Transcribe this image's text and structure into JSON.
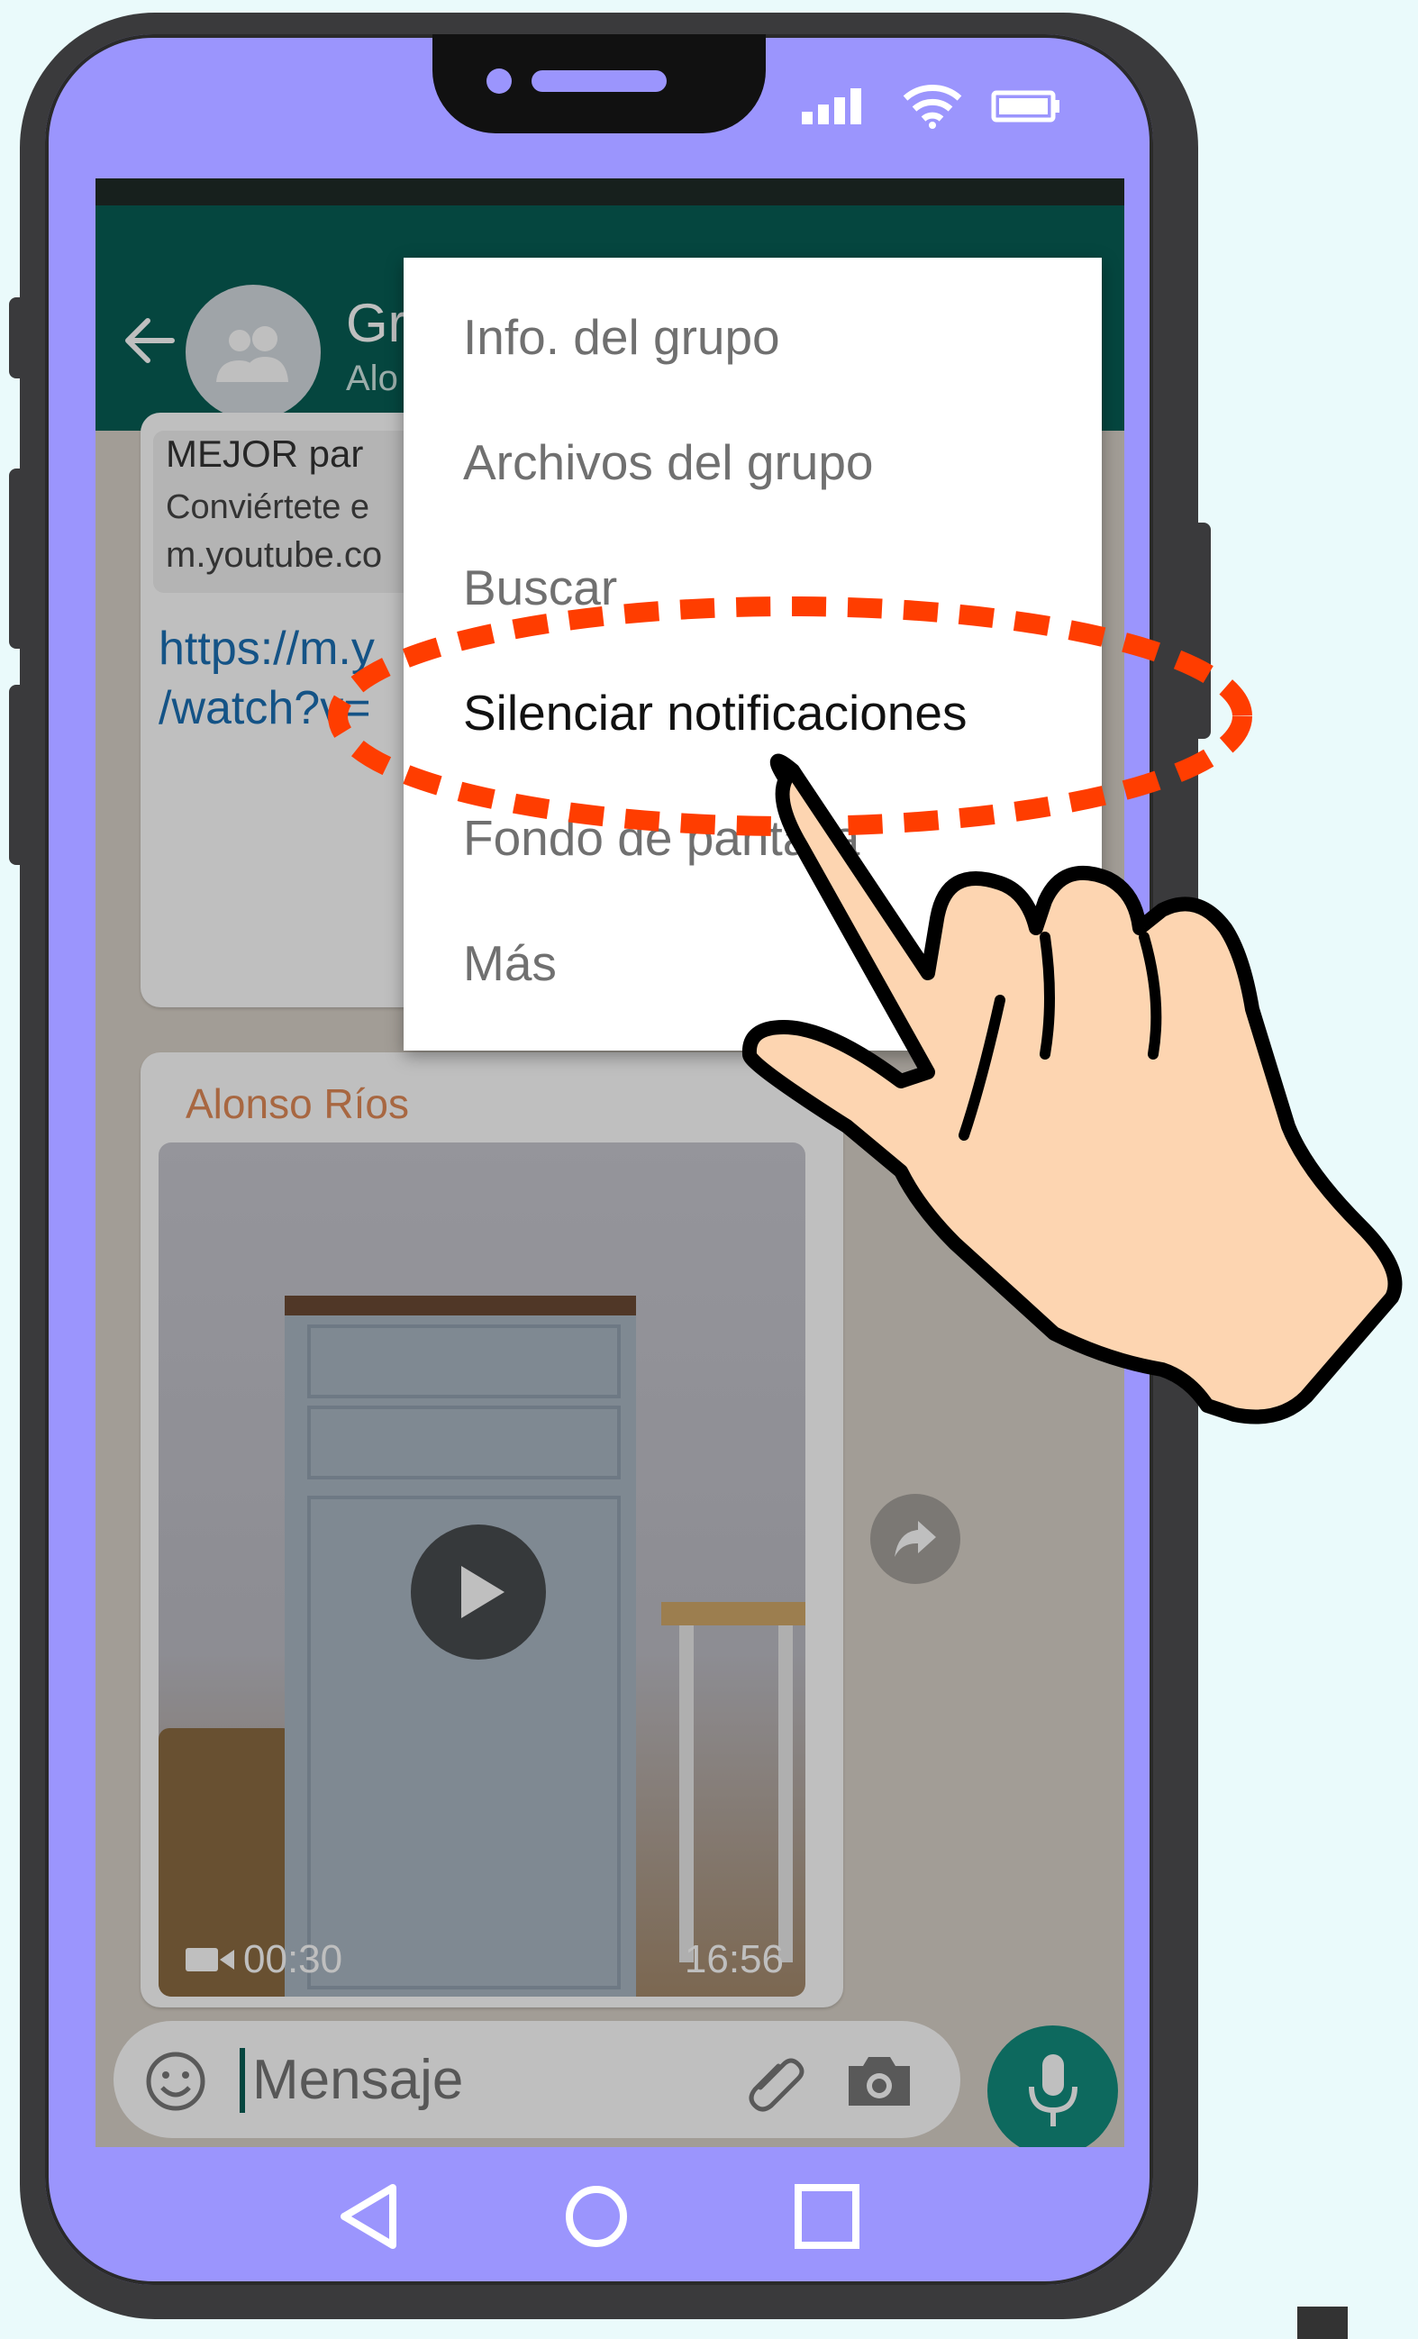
{
  "status_bar": {
    "signal_icon": "signal-icon",
    "wifi_icon": "wifi-icon",
    "battery_icon": "battery-icon"
  },
  "chat_header": {
    "title": "Gr",
    "subtitle": "Alo",
    "back_icon": "arrow-left-icon",
    "avatar_icon": "group-avatar-icon"
  },
  "messages": {
    "link_preview": {
      "title": "MEJOR par",
      "description": "Conviértete e",
      "domain": "m.youtube.co"
    },
    "link_lines": [
      "https://m.y",
      "/watch?v="
    ],
    "video_message": {
      "sender": "Alonso Ríos",
      "duration": "00:30",
      "time": "16:56"
    }
  },
  "menu": {
    "items": [
      {
        "label": "Info. del grupo",
        "highlighted": false
      },
      {
        "label": "Archivos del grupo",
        "highlighted": false
      },
      {
        "label": "Buscar",
        "highlighted": false
      },
      {
        "label": "Silenciar notificaciones",
        "highlighted": true
      },
      {
        "label": "Fondo de pantalla",
        "highlighted": false
      },
      {
        "label": "Más",
        "highlighted": false
      }
    ]
  },
  "input_bar": {
    "placeholder": "Mensaje",
    "emoji_icon": "emoji-icon",
    "attach_icon": "paperclip-icon",
    "camera_icon": "camera-icon",
    "mic_icon": "microphone-icon"
  },
  "nav_bar": {
    "back": "triangle-back-icon",
    "home": "circle-home-icon",
    "recent": "square-recent-icon"
  },
  "colors": {
    "phone_frame": "#9b95fd",
    "app_header": "#075e54",
    "highlight_dashes": "#ff3d00",
    "hand_skin": "#fdd5b1"
  }
}
